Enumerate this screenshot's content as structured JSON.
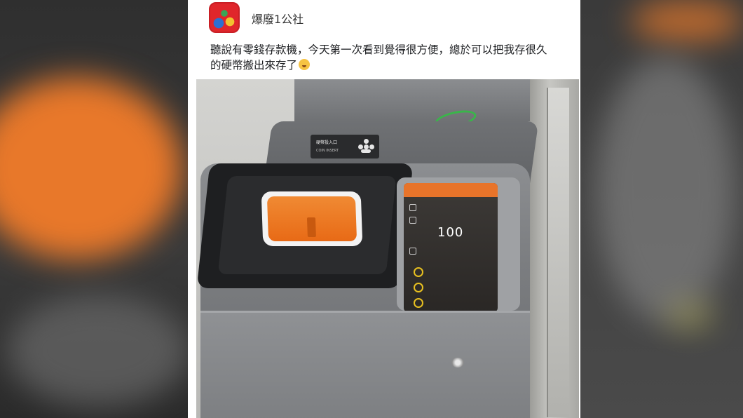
{
  "post": {
    "page_name": "爆廢1公社",
    "text_line1": "聽說有零錢存款機，今天第一次看到覺得很方便，總於可以把我存很久",
    "text_line2": "的硬幣搬出來存了"
  },
  "photo": {
    "label_cn": "硬幣投入口",
    "label_en": "COIN INSERT",
    "screen_big_value": "100"
  },
  "colors": {
    "accent_orange": "#e86a16",
    "machine_gray": "#7b7d80"
  },
  "icons": [
    "avatar-logo",
    "emoji-smile-sweat",
    "coin-icon"
  ]
}
